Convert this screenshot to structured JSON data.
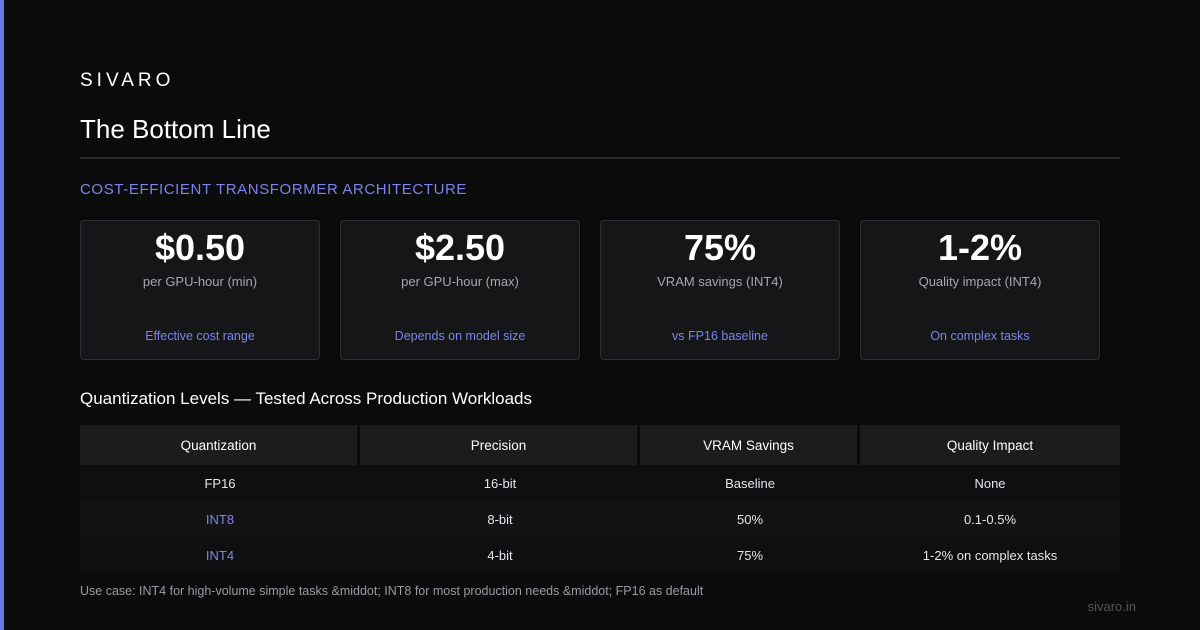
{
  "brand": "SIVARO",
  "title": "The Bottom Line",
  "section_label": "COST-EFFICIENT TRANSFORMER ARCHITECTURE",
  "cards": [
    {
      "value": "$0.50",
      "label": "per GPU-hour (min)",
      "note": "Effective cost range"
    },
    {
      "value": "$2.50",
      "label": "per GPU-hour (max)",
      "note": "Depends on model size"
    },
    {
      "value": "75%",
      "label": "VRAM savings (INT4)",
      "note": "vs FP16 baseline"
    },
    {
      "value": "1-2%",
      "label": "Quality impact (INT4)",
      "note": "On complex tasks"
    }
  ],
  "table_heading": "Quantization Levels — Tested Across Production Workloads",
  "table": {
    "headers": [
      "Quantization",
      "Precision",
      "VRAM Savings",
      "Quality Impact"
    ],
    "rows": [
      [
        "FP16",
        "16-bit",
        "Baseline",
        "None"
      ],
      [
        "INT8",
        "8-bit",
        "50%",
        "0.1-0.5%"
      ],
      [
        "INT4",
        "4-bit",
        "75%",
        "1-2% on complex tasks"
      ]
    ]
  },
  "footnote": "Use case: INT4 for high-volume simple tasks &middot; INT8 for most production needs &middot; FP16 as default",
  "site": "sivaro.in",
  "colors": {
    "accent": "#6b76e8",
    "accent_text": "#7b84ee",
    "background": "#0b0b0c"
  }
}
